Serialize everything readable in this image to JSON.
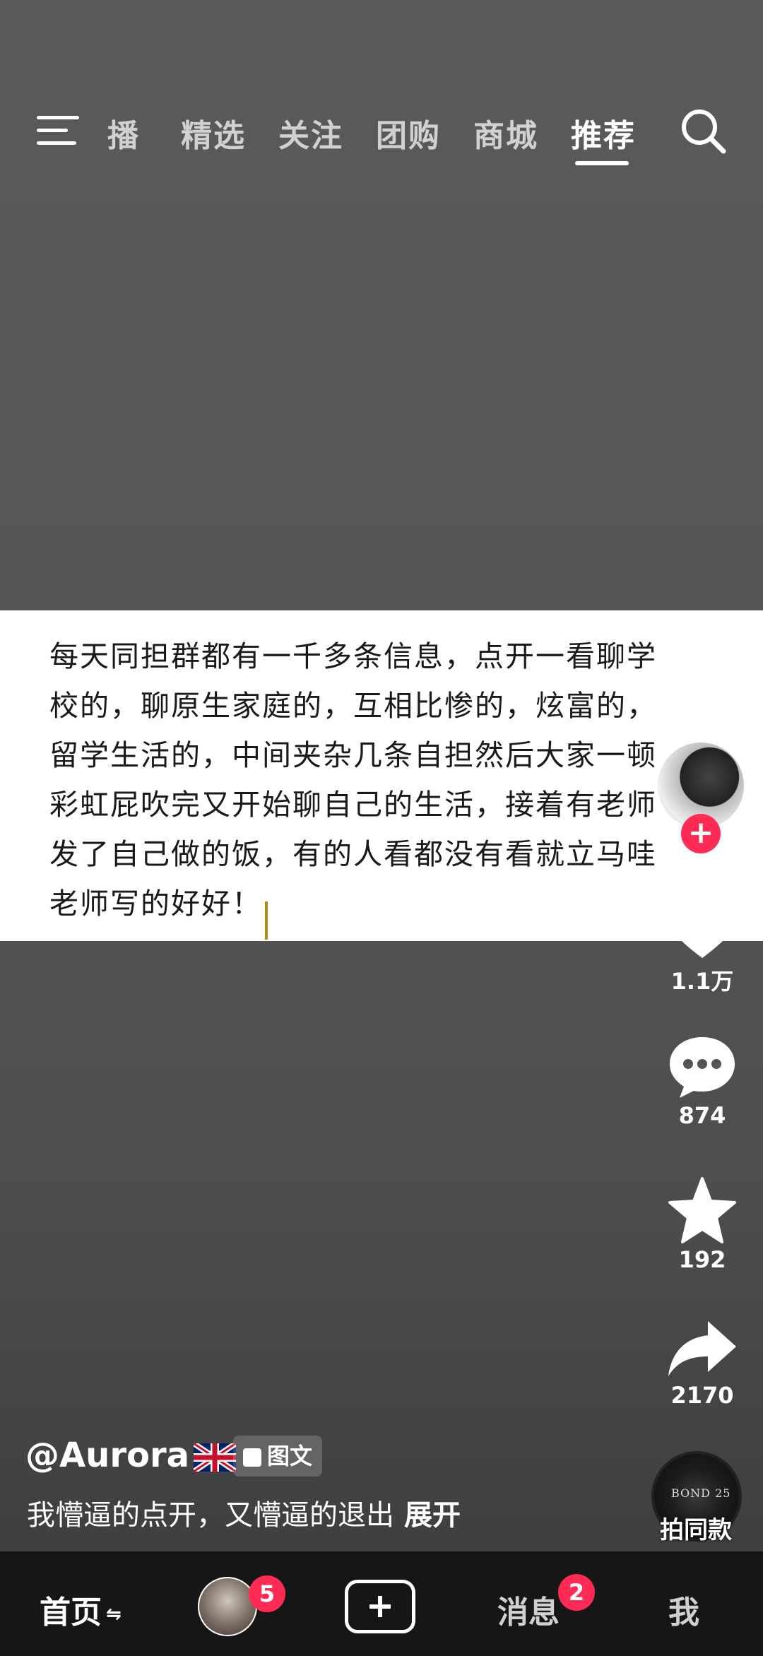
{
  "top_nav": {
    "tabs": [
      {
        "label": "播"
      },
      {
        "label": "精选"
      },
      {
        "label": "关注"
      },
      {
        "label": "团购"
      },
      {
        "label": "商城"
      },
      {
        "label": "推荐"
      }
    ],
    "active_tab": "推荐"
  },
  "post": {
    "text_lines": [
      "每天同担群都有一千多条信息，点开一看聊学",
      "校的，聊原生家庭的，互相比惨的，炫富的，",
      "留学生活的，中间夹杂几条自担然后大家一顿",
      "彩虹屁吹完又开始聊自己的生活，接着有老师",
      "发了自己做的饭，有的人看都没有看就立马哇",
      "老师写的好好！"
    ]
  },
  "actions": {
    "likes": "1.1万",
    "comments": "874",
    "favorites": "192",
    "shares": "2170"
  },
  "follow_symbol": "+",
  "author": {
    "username": "@Aurora",
    "post_type": "图文"
  },
  "caption": {
    "text": "我懵逼的点开，又懵逼的退出",
    "expand_label": "展开"
  },
  "music": {
    "disc_text": "BOND 25",
    "same_label": "拍同款"
  },
  "bottom_bar": {
    "home": "首页",
    "friends_badge": "5",
    "messages": "消息",
    "messages_badge": "2",
    "me": "我"
  },
  "colors": {
    "accent_red": "#fe2c55",
    "card_bg": "#ffffff",
    "cursor": "#b08a14"
  }
}
